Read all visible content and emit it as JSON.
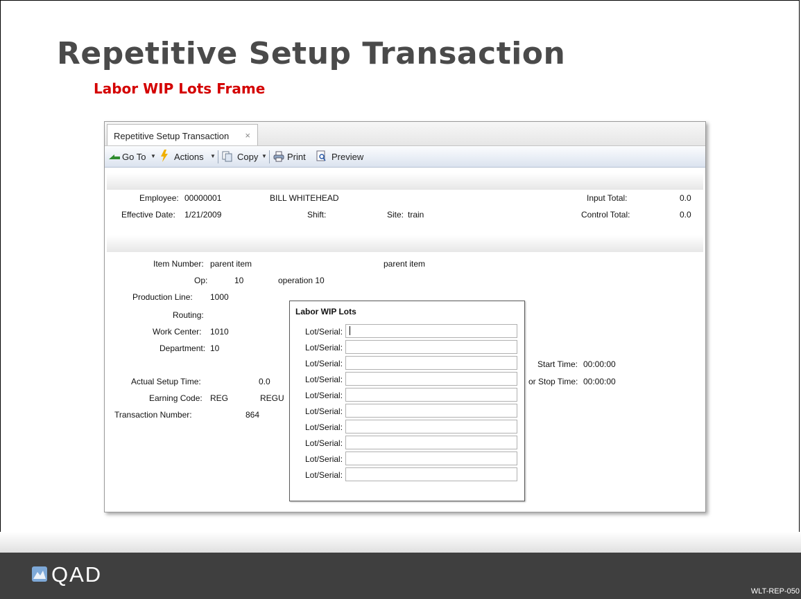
{
  "slide": {
    "title": "Repetitive Setup Transaction",
    "subtitle": "Labor WIP Lots Frame",
    "code": "WLT-REP-050",
    "logo": "QAD"
  },
  "tab": {
    "label": "Repetitive Setup Transaction",
    "close": "×"
  },
  "toolbar": {
    "goto": "Go To",
    "actions": "Actions",
    "copy": "Copy",
    "print": "Print",
    "preview": "Preview"
  },
  "header": {
    "employee_label": "Employee:",
    "employee_value": "00000001",
    "employee_name": "BILL WHITEHEAD",
    "input_total_label": "Input Total:",
    "input_total_value": "0.0",
    "effective_date_label": "Effective Date:",
    "effective_date_value": "1/21/2009",
    "shift_label": "Shift:",
    "site_label": "Site:",
    "site_value": "train",
    "control_total_label": "Control Total:",
    "control_total_value": "0.0"
  },
  "detail": {
    "item_number_label": "Item Number:",
    "item_number_value": "parent item",
    "item_desc": "parent item",
    "op_label": "Op:",
    "op_value": "10",
    "op_desc": "operation 10",
    "production_line_label": "Production Line:",
    "production_line_value": "1000",
    "routing_label": "Routing:",
    "work_center_label": "Work Center:",
    "work_center_value": "1010",
    "department_label": "Department:",
    "department_value": "10",
    "start_time_label": "Start Time:",
    "start_time_value": "00:00:00",
    "stop_time_label": "or Stop Time:",
    "stop_time_value": "00:00:00",
    "actual_setup_time_label": "Actual Setup Time:",
    "actual_setup_time_value": "0.0",
    "earning_code_label": "Earning Code:",
    "earning_code_value": "REG",
    "earning_code_desc": "REGU",
    "transaction_number_label": "Transaction Number:",
    "transaction_number_value": "864"
  },
  "dialog": {
    "title": "Labor WIP Lots",
    "lots": [
      {
        "label": "Lot/Serial:",
        "value": ""
      },
      {
        "label": "Lot/Serial:",
        "value": ""
      },
      {
        "label": "Lot/Serial:",
        "value": ""
      },
      {
        "label": "Lot/Serial:",
        "value": ""
      },
      {
        "label": "Lot/Serial:",
        "value": ""
      },
      {
        "label": "Lot/Serial:",
        "value": ""
      },
      {
        "label": "Lot/Serial:",
        "value": ""
      },
      {
        "label": "Lot/Serial:",
        "value": ""
      },
      {
        "label": "Lot/Serial:",
        "value": ""
      },
      {
        "label": "Lot/Serial:",
        "value": ""
      }
    ]
  }
}
